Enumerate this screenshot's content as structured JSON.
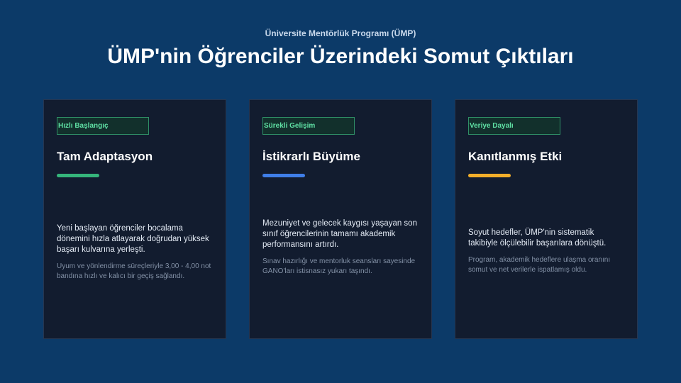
{
  "header": {
    "subtitle": "Üniversite Mentörlük Programı (ÜMP)",
    "title": "ÜMP'nin Öğrenciler Üzerindeki Somut Çıktıları"
  },
  "cards": [
    {
      "tag": "Hızlı Başlangıç",
      "title": "Tam Adaptasyon",
      "accent_color": "#35b57b",
      "text": "Yeni başlayan öğrenciler bocalama dönemini hızla atlayarak doğrudan yüksek başarı kulvarına yerleşti.",
      "note": "Uyum ve yönlendirme süreçleriyle 3,00 - 4,00 not bandına hızlı ve kalıcı bir geçiş sağlandı."
    },
    {
      "tag": "Sürekli Gelişim",
      "title": "İstikrarlı Büyüme",
      "accent_color": "#3f7ee8",
      "text": "Mezuniyet ve gelecek kaygısı yaşayan son sınıf öğrencilerinin tamamı akademik performansını artırdı.",
      "note": "Sınav hazırlığı ve mentorluk seansları sayesinde GANO'ları istisnasız yukarı taşındı."
    },
    {
      "tag": "Veriye Dayalı",
      "title": "Kanıtlanmış Etki",
      "accent_color": "#f2ae2a",
      "text": "Soyut hedefler, ÜMP'nin sistematik takibiyle ölçülebilir başarılara dönüştü.",
      "note": "Program, akademik hedeflere ulaşma oranını somut ve net verilerle ispatlamış oldu."
    }
  ],
  "colors": {
    "background": "#0c3a68",
    "card_background": "#121c2f",
    "tag_text": "#5fe0a4"
  }
}
